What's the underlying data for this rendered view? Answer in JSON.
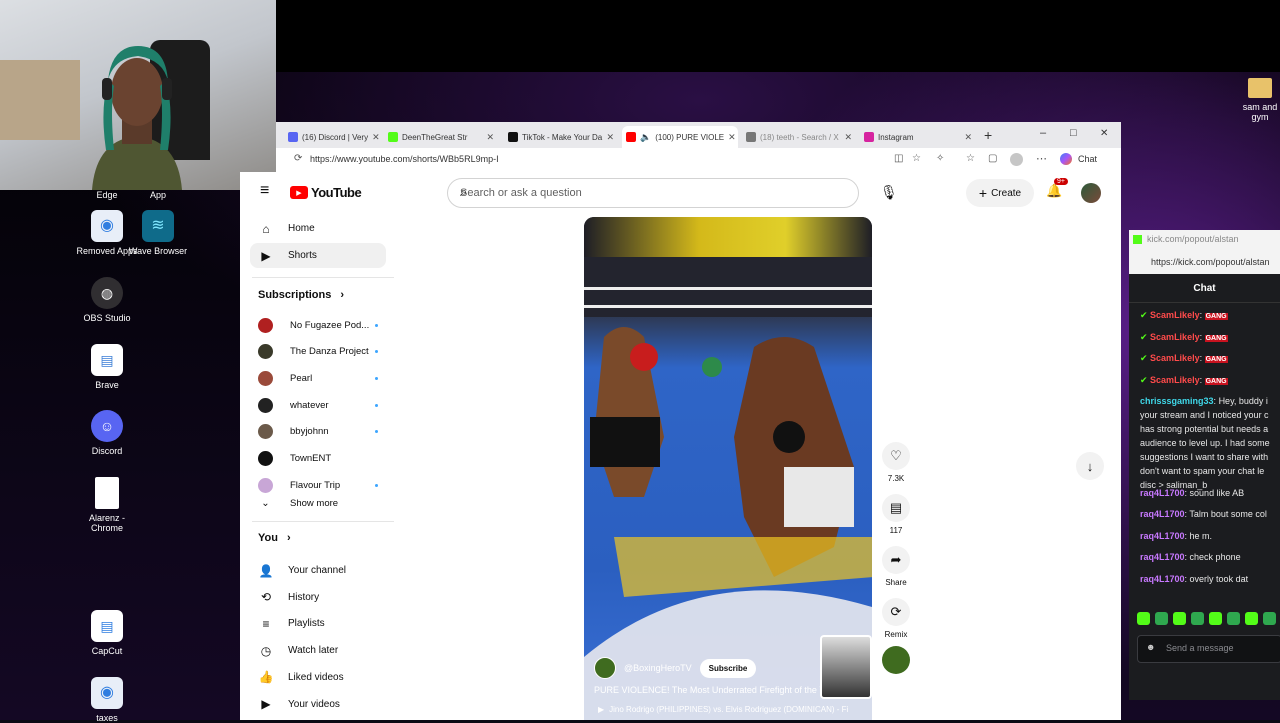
{
  "desktop": {
    "icons": [
      {
        "label": "Edge",
        "color": "#1b83d6"
      },
      {
        "label": "App",
        "color": "#2b2b2b"
      },
      {
        "label": "Removed Apps",
        "color": "#2f7de0"
      },
      {
        "label": "Wave Browser",
        "color": "#1a9bc4"
      },
      {
        "label": "OBS Studio",
        "color": "#302e31"
      },
      {
        "label": "Brave",
        "color": "#3b7ed6"
      },
      {
        "label": "Discord",
        "color": "#5865f2"
      },
      {
        "label": "Alarenz - Chrome",
        "color": "#ffffff"
      },
      {
        "label": "CapCut",
        "color": "#2f7de0"
      },
      {
        "label": "taxes",
        "color": "#2f7de0"
      },
      {
        "label": "sam and gym",
        "color": "#e8c26a"
      }
    ]
  },
  "browser": {
    "tabs": [
      {
        "label": "(16) Discord | Very",
        "color": "#5865f2",
        "active": false
      },
      {
        "label": "DeenTheGreat Str",
        "color": "#53fc18",
        "active": false
      },
      {
        "label": "TikTok - Make Your Da",
        "color": "#111111",
        "active": false
      },
      {
        "label": "(100) PURE VIOLE",
        "color": "#ff0000",
        "active": true
      },
      {
        "label": "(18) teeth - Search / X",
        "color": "#777777",
        "active": false
      },
      {
        "label": "Instagram",
        "color": "#d6249f",
        "active": false
      }
    ],
    "url": "https://www.youtube.com/shorts/WBb5RL9mp-I",
    "chat_label": "Chat",
    "new_tab": "+",
    "win_min": "–",
    "win_max": "□",
    "win_close": "✕"
  },
  "youtube": {
    "logo_text": "YouTube",
    "search_placeholder": "Search or ask a question",
    "create_label": "Create",
    "notif_badge": "9+",
    "nav": [
      {
        "label": "Home",
        "icon": "home-icon",
        "glyph": "⌂"
      },
      {
        "label": "Shorts",
        "icon": "shorts-icon",
        "glyph": "▶",
        "active": true
      }
    ],
    "subscriptions_title": "Subscriptions",
    "subscriptions": [
      {
        "label": "No Fugazee Pod...",
        "color": "#b02020",
        "dot": true
      },
      {
        "label": "The Danza Project",
        "color": "#3a3a2a",
        "dot": true
      },
      {
        "label": "Pearl",
        "color": "#9a4a3a",
        "dot": true
      },
      {
        "label": "whatever",
        "color": "#222222",
        "dot": true
      },
      {
        "label": "bbyjohnn",
        "color": "#6b5a4a",
        "dot": true
      },
      {
        "label": "TownENT",
        "color": "#111111",
        "dot": false
      },
      {
        "label": "Flavour Trip",
        "color": "#c8a6d6",
        "dot": true
      }
    ],
    "show_more": "Show more",
    "you_title": "You",
    "you_items": [
      {
        "label": "Your channel",
        "glyph": "👤"
      },
      {
        "label": "History",
        "glyph": "⟲"
      },
      {
        "label": "Playlists",
        "glyph": "≡"
      },
      {
        "label": "Watch later",
        "glyph": "◷"
      },
      {
        "label": "Liked videos",
        "glyph": "👍"
      },
      {
        "label": "Your videos",
        "glyph": "▶"
      }
    ],
    "short": {
      "channel": "@BoxingHeroTV",
      "subscribe": "Subscribe",
      "title": "PURE VIOLENCE! The Most Underrated Firefight of the Year! | ...",
      "music": "Jino Rodrigo (PHILIPPINES) vs. Elvis Rodriguez (DOMINICAN) - Fi..."
    },
    "actions": [
      {
        "label": "7.3K",
        "icon": "like-icon",
        "glyph": "♡"
      },
      {
        "label": "117",
        "icon": "comment-icon",
        "glyph": "▤"
      },
      {
        "label": "Share",
        "icon": "share-icon",
        "glyph": "➦"
      },
      {
        "label": "Remix",
        "icon": "remix-icon",
        "glyph": "⟳"
      }
    ]
  },
  "kick": {
    "url": "kick.com/popout/alstan",
    "url_full": "https://kick.com/popout/alstan",
    "title": "Chat",
    "messages": [
      {
        "user": "ScamLikely",
        "color": "#ff4b4b",
        "text": "GANG",
        "badge": true
      },
      {
        "user": "ScamLikely",
        "color": "#ff4b4b",
        "text": "GANG",
        "badge": true
      },
      {
        "user": "ScamLikely",
        "color": "#ff4b4b",
        "text": "GANG",
        "badge": true
      },
      {
        "user": "ScamLikely",
        "color": "#ff4b4b",
        "text": "GANG",
        "badge": true
      },
      {
        "user": "chrisssgaming33",
        "color": "#3fd7e8",
        "text": "Hey, buddy i your stream and I noticed your c has strong potential but needs a audience to level up. I had some suggestions I want to share with don't want to spam your chat le disc > saliman_b",
        "badge": false
      },
      {
        "user": "raq4L1700",
        "color": "#c879ff",
        "text": "sound like AB",
        "badge": false
      },
      {
        "user": "raq4L1700",
        "color": "#c879ff",
        "text": "Talm bout some col",
        "badge": false
      },
      {
        "user": "raq4L1700",
        "color": "#c879ff",
        "text": "he m.",
        "badge": false
      },
      {
        "user": "raq4L1700",
        "color": "#c879ff",
        "text": "check phone",
        "badge": false
      },
      {
        "user": "raq4L1700",
        "color": "#c879ff",
        "text": "overly took dat",
        "badge": false
      }
    ],
    "input_placeholder": "Send a message"
  }
}
